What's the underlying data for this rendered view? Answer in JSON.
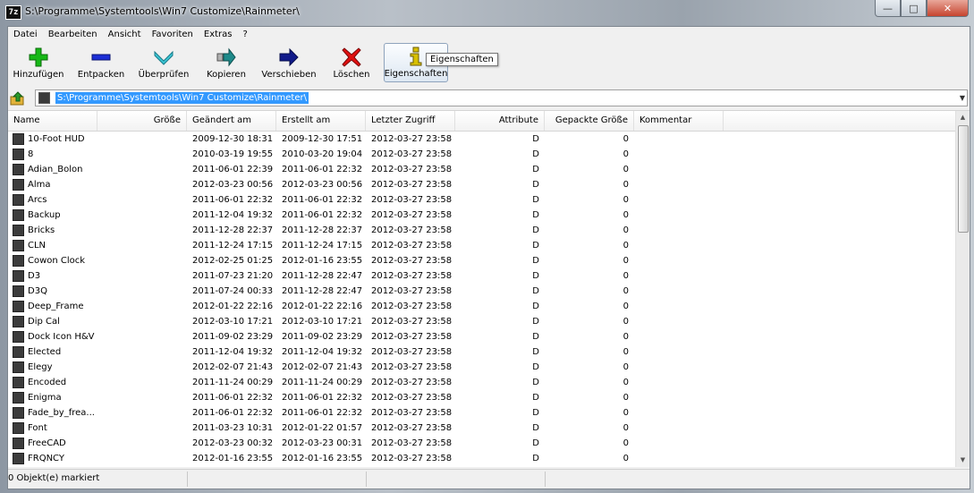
{
  "window": {
    "title": "S:\\Programme\\Systemtools\\Win7 Customize\\Rainmeter\\",
    "app_icon_text": "7z",
    "controls": {
      "minimize": "—",
      "maximize": "□",
      "close": "✕"
    }
  },
  "menu": [
    "Datei",
    "Bearbeiten",
    "Ansicht",
    "Favoriten",
    "Extras",
    "?"
  ],
  "toolbar": [
    {
      "label": "Hinzufügen",
      "icon": "plus-icon",
      "color": "#16b816"
    },
    {
      "label": "Entpacken",
      "icon": "minus-icon",
      "color": "#1c2fd6"
    },
    {
      "label": "Überprüfen",
      "icon": "check-icon",
      "color": "#3cc7d6"
    },
    {
      "label": "Kopieren",
      "icon": "copy-arrow-icon",
      "color": "#1e8a8a"
    },
    {
      "label": "Verschieben",
      "icon": "move-arrow-icon",
      "color": "#101a8a"
    },
    {
      "label": "Löschen",
      "icon": "delete-x-icon",
      "color": "#e01010"
    },
    {
      "label": "Eigenschaften",
      "icon": "info-icon",
      "color": "#d8c000"
    }
  ],
  "tooltip": "Eigenschaften",
  "address": {
    "path": "S:\\Programme\\Systemtools\\Win7 Customize\\Rainmeter\\"
  },
  "columns": [
    "Name",
    "Größe",
    "Geändert am",
    "Erstellt am",
    "Letzter Zugriff",
    "Attribute",
    "Gepackte Größe",
    "Kommentar"
  ],
  "rows": [
    {
      "name": "10-Foot HUD",
      "size": "",
      "modified": "2009-12-30 18:31",
      "created": "2009-12-30 17:51",
      "accessed": "2012-03-27 23:58",
      "attr": "D",
      "packed": "0"
    },
    {
      "name": "8",
      "size": "",
      "modified": "2010-03-19 19:55",
      "created": "2010-03-20 19:04",
      "accessed": "2012-03-27 23:58",
      "attr": "D",
      "packed": "0"
    },
    {
      "name": "Adian_Bolon",
      "size": "",
      "modified": "2011-06-01 22:39",
      "created": "2011-06-01 22:32",
      "accessed": "2012-03-27 23:58",
      "attr": "D",
      "packed": "0"
    },
    {
      "name": "Alma",
      "size": "",
      "modified": "2012-03-23 00:56",
      "created": "2012-03-23 00:56",
      "accessed": "2012-03-27 23:58",
      "attr": "D",
      "packed": "0"
    },
    {
      "name": "Arcs",
      "size": "",
      "modified": "2011-06-01 22:32",
      "created": "2011-06-01 22:32",
      "accessed": "2012-03-27 23:58",
      "attr": "D",
      "packed": "0"
    },
    {
      "name": "Backup",
      "size": "",
      "modified": "2011-12-04 19:32",
      "created": "2011-06-01 22:32",
      "accessed": "2012-03-27 23:58",
      "attr": "D",
      "packed": "0"
    },
    {
      "name": "Bricks",
      "size": "",
      "modified": "2011-12-28 22:37",
      "created": "2011-12-28 22:37",
      "accessed": "2012-03-27 23:58",
      "attr": "D",
      "packed": "0"
    },
    {
      "name": "CLN",
      "size": "",
      "modified": "2011-12-24 17:15",
      "created": "2011-12-24 17:15",
      "accessed": "2012-03-27 23:58",
      "attr": "D",
      "packed": "0"
    },
    {
      "name": "Cowon Clock",
      "size": "",
      "modified": "2012-02-25 01:25",
      "created": "2012-01-16 23:55",
      "accessed": "2012-03-27 23:58",
      "attr": "D",
      "packed": "0"
    },
    {
      "name": "D3",
      "size": "",
      "modified": "2011-07-23 21:20",
      "created": "2011-12-28 22:47",
      "accessed": "2012-03-27 23:58",
      "attr": "D",
      "packed": "0"
    },
    {
      "name": "D3Q",
      "size": "",
      "modified": "2011-07-24 00:33",
      "created": "2011-12-28 22:47",
      "accessed": "2012-03-27 23:58",
      "attr": "D",
      "packed": "0"
    },
    {
      "name": "Deep_Frame",
      "size": "",
      "modified": "2012-01-22 22:16",
      "created": "2012-01-22 22:16",
      "accessed": "2012-03-27 23:58",
      "attr": "D",
      "packed": "0"
    },
    {
      "name": "Dip Cal",
      "size": "",
      "modified": "2012-03-10 17:21",
      "created": "2012-03-10 17:21",
      "accessed": "2012-03-27 23:58",
      "attr": "D",
      "packed": "0"
    },
    {
      "name": "Dock Icon H&V",
      "size": "",
      "modified": "2011-09-02 23:29",
      "created": "2011-09-02 23:29",
      "accessed": "2012-03-27 23:58",
      "attr": "D",
      "packed": "0"
    },
    {
      "name": "Elected",
      "size": "",
      "modified": "2011-12-04 19:32",
      "created": "2011-12-04 19:32",
      "accessed": "2012-03-27 23:58",
      "attr": "D",
      "packed": "0"
    },
    {
      "name": "Elegy",
      "size": "",
      "modified": "2012-02-07 21:43",
      "created": "2012-02-07 21:43",
      "accessed": "2012-03-27 23:58",
      "attr": "D",
      "packed": "0"
    },
    {
      "name": "Encoded",
      "size": "",
      "modified": "2011-11-24 00:29",
      "created": "2011-11-24 00:29",
      "accessed": "2012-03-27 23:58",
      "attr": "D",
      "packed": "0"
    },
    {
      "name": "Enigma",
      "size": "",
      "modified": "2011-06-01 22:32",
      "created": "2011-06-01 22:32",
      "accessed": "2012-03-27 23:58",
      "attr": "D",
      "packed": "0"
    },
    {
      "name": "Fade_by_frea...",
      "size": "",
      "modified": "2011-06-01 22:32",
      "created": "2011-06-01 22:32",
      "accessed": "2012-03-27 23:58",
      "attr": "D",
      "packed": "0"
    },
    {
      "name": "Font",
      "size": "",
      "modified": "2011-03-23 10:31",
      "created": "2012-01-22 01:57",
      "accessed": "2012-03-27 23:58",
      "attr": "D",
      "packed": "0"
    },
    {
      "name": "FreeCAD",
      "size": "",
      "modified": "2012-03-23 00:32",
      "created": "2012-03-23 00:31",
      "accessed": "2012-03-27 23:58",
      "attr": "D",
      "packed": "0"
    },
    {
      "name": "FRQNCY",
      "size": "",
      "modified": "2012-01-16 23:55",
      "created": "2012-01-16 23:55",
      "accessed": "2012-03-27 23:58",
      "attr": "D",
      "packed": "0"
    }
  ],
  "status": {
    "selected": "0 Objekt(e) markiert"
  }
}
